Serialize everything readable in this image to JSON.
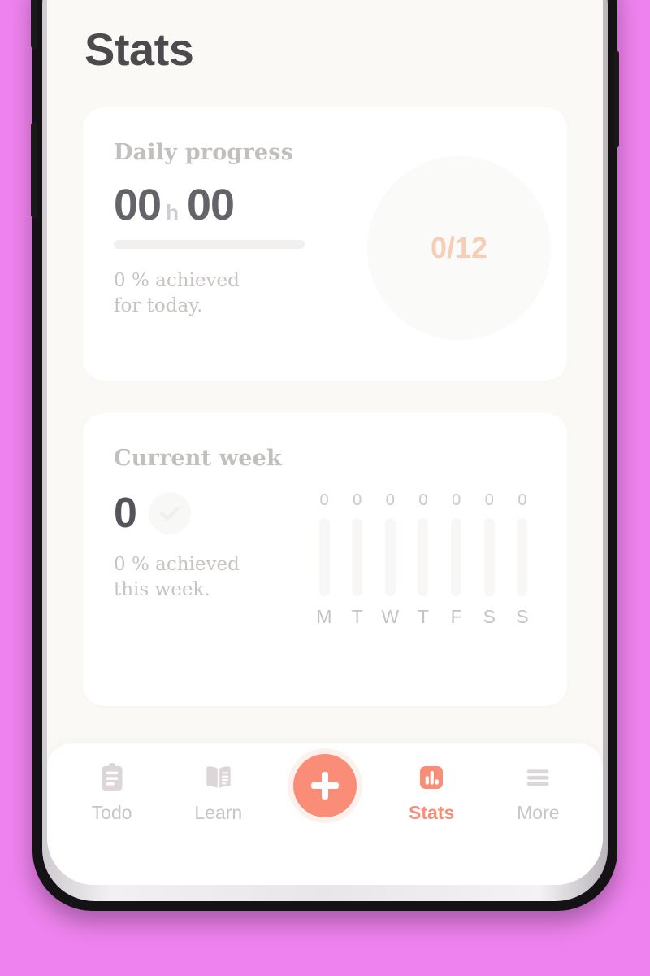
{
  "page": {
    "title": "Stats"
  },
  "daily_card": {
    "title": "Daily progress",
    "hours": "00",
    "unit": "h",
    "minutes": "00",
    "progress_percent": 0,
    "sub_line_1": "0 % achieved",
    "sub_line_2": "for today.",
    "goal_text": "0/12",
    "goal_color": "#f7cdb6"
  },
  "week_card": {
    "title": "Current week",
    "count": "0",
    "check_icon": "check-icon",
    "sub_line_1": "0 % achieved",
    "sub_line_2": "this week."
  },
  "chart_data": {
    "type": "bar",
    "title": "Current week",
    "categories": [
      "M",
      "T",
      "W",
      "T",
      "F",
      "S",
      "S"
    ],
    "values": [
      0,
      0,
      0,
      0,
      0,
      0,
      0
    ],
    "value_labels": [
      "0",
      "0",
      "0",
      "0",
      "0",
      "0",
      "0"
    ],
    "xlabel": "",
    "ylabel": "",
    "ylim": [
      0,
      12
    ],
    "grid": false,
    "legend": false,
    "bar_color": "#f98d77",
    "track_color": "#f8f7f5"
  },
  "bottom_nav": {
    "items": [
      {
        "label": "Todo",
        "icon": "clipboard-icon",
        "active": false
      },
      {
        "label": "Learn",
        "icon": "book-icon",
        "active": false
      },
      {
        "label": "Stats",
        "icon": "bar-chart-icon",
        "active": true
      },
      {
        "label": "More",
        "icon": "hamburger-icon",
        "active": false
      }
    ],
    "fab": {
      "icon": "plus-icon",
      "color": "#f98d77"
    }
  },
  "theme": {
    "accent": "#f98d77",
    "app_background": "#faf9f5",
    "card_background": "#ffffff",
    "backdrop": "#ee82ee",
    "muted_text": "#c6c3c1",
    "dark_text": "#4c4a4d"
  }
}
